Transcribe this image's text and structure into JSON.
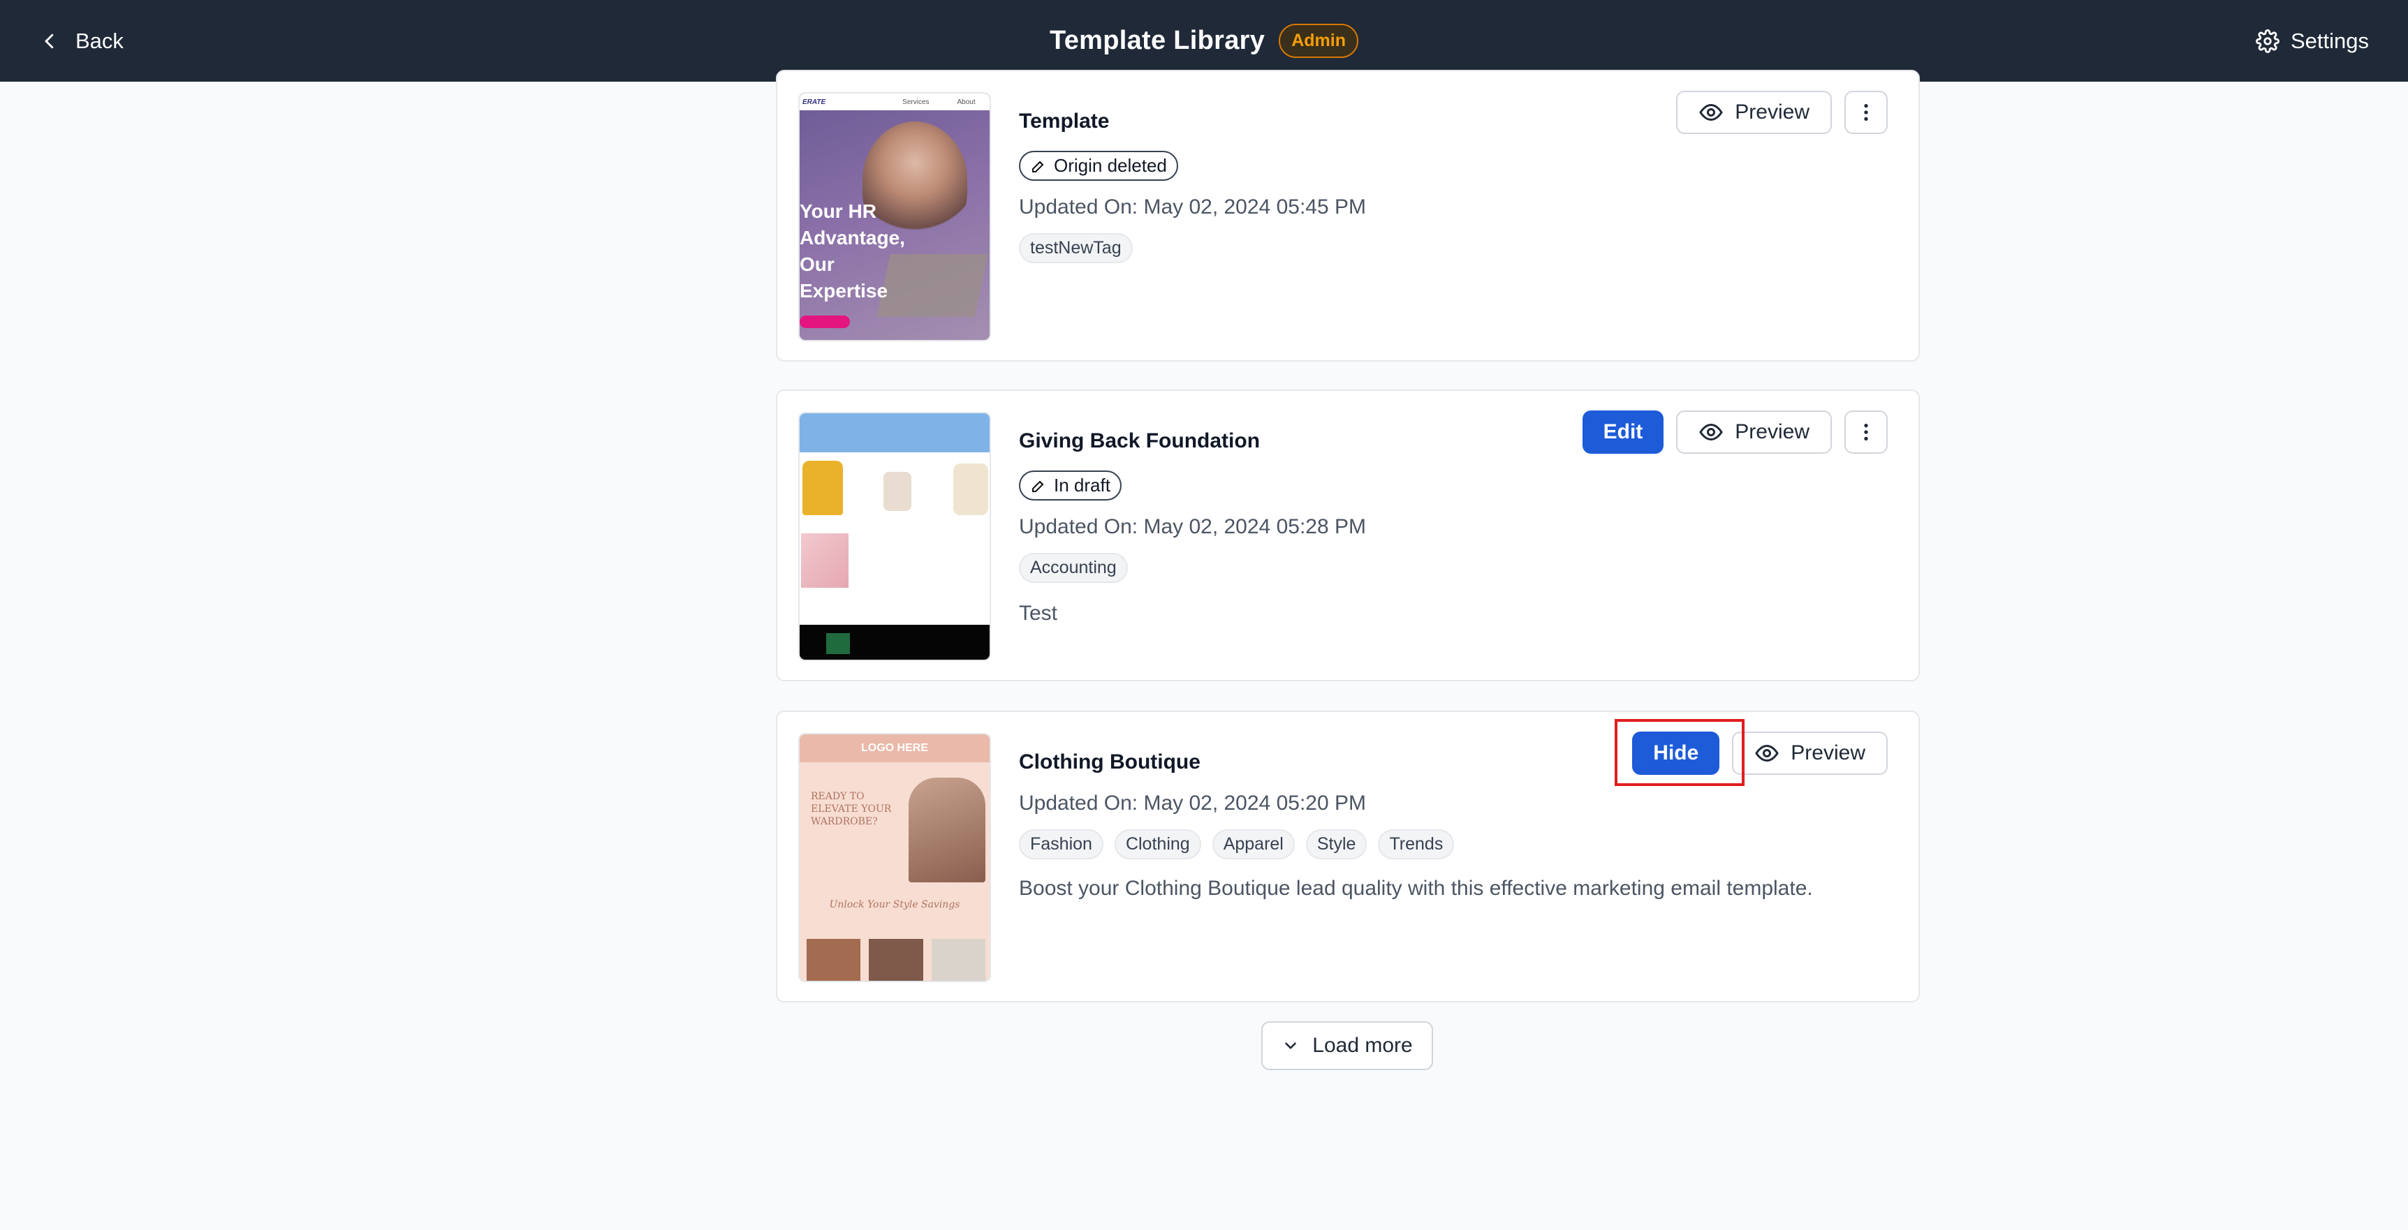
{
  "header": {
    "back_label": "Back",
    "title": "Template Library",
    "badge": "Admin",
    "settings_label": "Settings"
  },
  "templates": [
    {
      "title": "Template",
      "status": "Origin deleted",
      "updated": "Updated On: May 02, 2024 05:45 PM",
      "tags": [
        "testNewTag"
      ],
      "description": "",
      "actions": {
        "preview": "Preview"
      },
      "thumb": {
        "lines": [
          "Your HR",
          "Advantage,",
          "Our",
          "Expertise"
        ],
        "brand": "ERATE",
        "nav": [
          "Services",
          "About"
        ]
      }
    },
    {
      "title": "Giving Back Foundation",
      "status": "In draft",
      "updated": "Updated On: May 02, 2024 05:28 PM",
      "tags": [
        "Accounting"
      ],
      "description": "Test",
      "actions": {
        "edit": "Edit",
        "preview": "Preview"
      }
    },
    {
      "title": "Clothing Boutique",
      "status": "",
      "updated": "Updated On: May 02, 2024 05:20 PM",
      "tags": [
        "Fashion",
        "Clothing",
        "Apparel",
        "Style",
        "Trends"
      ],
      "description": "Boost your Clothing Boutique lead quality with this effective marketing email template.",
      "actions": {
        "hide": "Hide",
        "preview": "Preview"
      },
      "thumb": {
        "logo": "LOGO HERE",
        "headline": "READY TO ELEVATE YOUR WARDROBE?",
        "sub": "Unlock Your Style Savings"
      }
    }
  ],
  "load_more_label": "Load more",
  "colors": {
    "header_bg": "#1f2937",
    "primary": "#1d5bd8",
    "badge": "#f59e0b",
    "highlight": "#e01e1e"
  }
}
